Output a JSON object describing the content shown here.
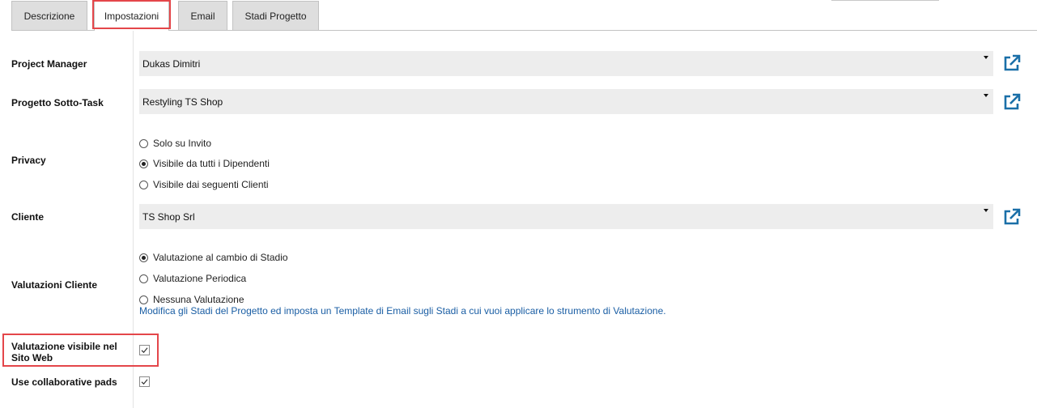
{
  "tabs": [
    {
      "label": "Descrizione",
      "active": false
    },
    {
      "label": "Impostazioni",
      "active": true
    },
    {
      "label": "Email",
      "active": false
    },
    {
      "label": "Stadi Progetto",
      "active": false
    }
  ],
  "fields": {
    "project_manager": {
      "label": "Project Manager",
      "value": "Dukas Dimitri"
    },
    "progetto_sotto_task": {
      "label": "Progetto Sotto-Task",
      "value": "Restyling TS Shop"
    },
    "privacy": {
      "label": "Privacy",
      "options": [
        "Solo su Invito",
        "Visibile da tutti i Dipendenti",
        "Visibile dai seguenti Clienti"
      ],
      "selected": "Visibile da tutti i Dipendenti"
    },
    "cliente": {
      "label": "Cliente",
      "value": "TS Shop Srl"
    },
    "valutazioni_cliente": {
      "label": "Valutazioni Cliente",
      "options": [
        "Valutazione al cambio di Stadio",
        "Valutazione Periodica",
        "Nessuna Valutazione"
      ],
      "selected": "Valutazione al cambio di Stadio",
      "help_link": "Modifica gli Stadi del Progetto ed imposta un Template di Email sugli Stadi a cui vuoi applicare lo strumento di Valutazione."
    },
    "valutazione_visibile": {
      "label_line1": "Valutazione visibile nel",
      "label_line2": "Sito Web",
      "checked": true
    },
    "collaborative_pads": {
      "label": "Use collaborative pads",
      "checked": true
    }
  },
  "colors": {
    "highlight": "#e4464a",
    "link": "#1a5ea4",
    "external_icon": "#1a6fa8"
  },
  "icons": {
    "external_link": "external-link-icon",
    "dropdown": "caret-down-icon",
    "checkmark": "checkmark-icon"
  }
}
